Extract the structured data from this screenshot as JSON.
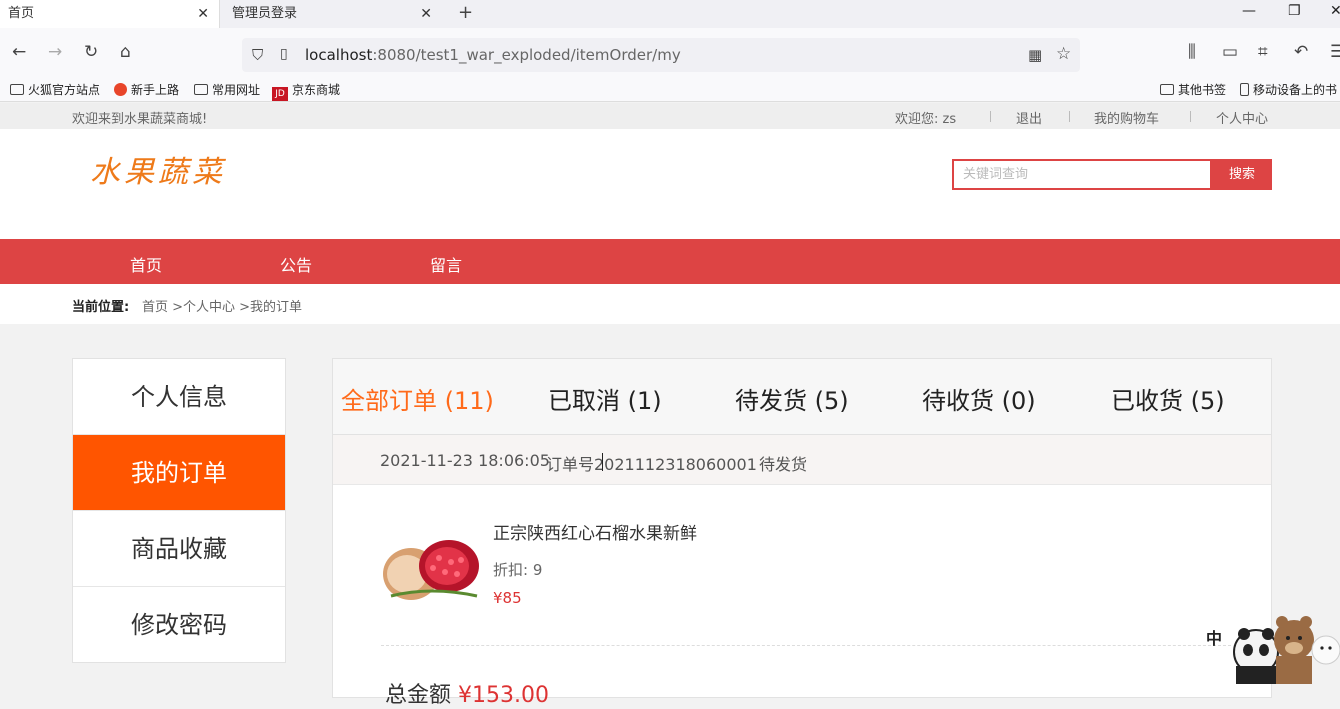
{
  "browser": {
    "tabs": [
      {
        "label": "首页",
        "active": true
      },
      {
        "label": "管理员登录",
        "active": false
      }
    ],
    "url_host": "localhost",
    "url_rest": ":8080/test1_war_exploded/itemOrder/my",
    "bookmarks": [
      "火狐官方站点",
      "新手上路",
      "常用网址",
      "京东商城"
    ],
    "bookmarks_right": [
      "其他书签",
      "移动设备上的书"
    ]
  },
  "topbar": {
    "welcome": "欢迎来到水果蔬菜商城!",
    "user_greeting": "欢迎您: zs",
    "logout": "退出",
    "cart": "我的购物车",
    "profile": "个人中心"
  },
  "header": {
    "logo_text": "水果蔬菜",
    "search_placeholder": "关键词查询",
    "search_button": "搜索"
  },
  "mainnav": [
    "首页",
    "公告",
    "留言"
  ],
  "breadcrumb": {
    "label": "当前位置:",
    "path": "首页 >个人中心 >我的订单"
  },
  "side_menu": [
    {
      "label": "个人信息",
      "active": false
    },
    {
      "label": "我的订单",
      "active": true
    },
    {
      "label": "商品收藏",
      "active": false
    },
    {
      "label": "修改密码",
      "active": false
    }
  ],
  "order_tabs": [
    {
      "label": "全部订单 (11)",
      "active": true
    },
    {
      "label": "已取消 (1)",
      "active": false
    },
    {
      "label": "待发货 (5)",
      "active": false
    },
    {
      "label": "待收货 (0)",
      "active": false
    },
    {
      "label": "已收货 (5)",
      "active": false
    }
  ],
  "order": {
    "time": "2021-11-23 18:06:05",
    "number": "订单号2021112318060001",
    "status": "待发货",
    "product_name": "正宗陕西红心石榴水果新鲜",
    "discount": "折扣: 9",
    "price": "¥85",
    "total_label": "总金额",
    "total_amount": "¥153.00"
  },
  "colors": {
    "brand_red": "#dd4444",
    "accent_orange": "#ff5500"
  }
}
